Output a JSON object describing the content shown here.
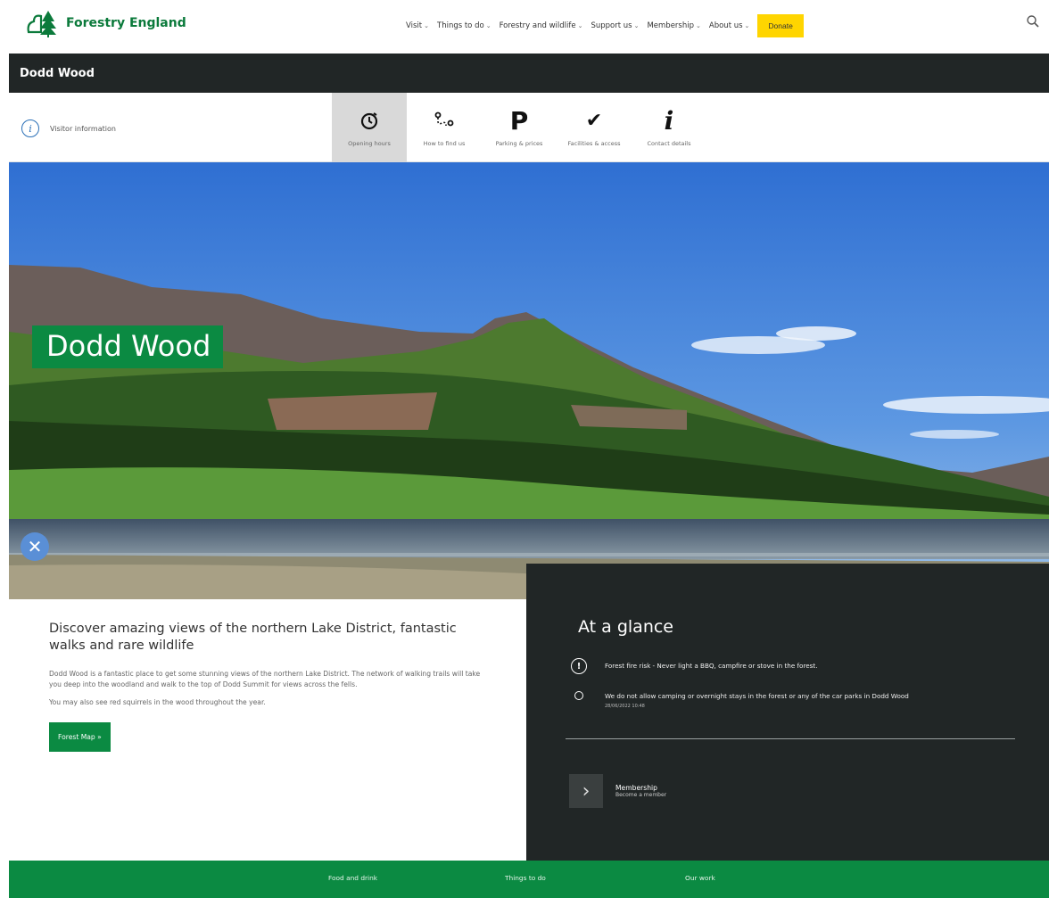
{
  "brand": {
    "name": "Forestry England"
  },
  "nav": {
    "items": [
      {
        "label": "Visit"
      },
      {
        "label": "Things to do"
      },
      {
        "label": "Forestry and wildlife"
      },
      {
        "label": "Support us"
      },
      {
        "label": "Membership"
      },
      {
        "label": "About us"
      }
    ],
    "chevron": "⌄",
    "donate_label": "Donate"
  },
  "title_bar": {
    "title": "Dodd Wood"
  },
  "visitor_info": {
    "label": "Visitor information",
    "tabs": [
      {
        "label": "Opening hours",
        "icon": "clock-icon",
        "active": true
      },
      {
        "label": "How to find us",
        "icon": "route-icon",
        "active": false
      },
      {
        "label": "Parking & prices",
        "icon": "parking-icon",
        "active": false
      },
      {
        "label": "Facilities & access",
        "icon": "checkmark-icon",
        "active": false
      },
      {
        "label": "Contact details",
        "icon": "info-icon",
        "active": false
      }
    ]
  },
  "hero": {
    "title": "Dodd Wood"
  },
  "intro": {
    "heading": "Discover amazing views of the northern Lake District, fantastic walks and rare wildlife",
    "paragraph1": "Dodd Wood is a fantastic place to get some stunning views of the northern Lake District. The network of walking trails will take you deep into the woodland and walk to the top of Dodd Summit for views across the fells.",
    "paragraph2": "You may also see red squirrels in the wood throughout the year.",
    "map_button": "Forest Map »"
  },
  "glance": {
    "title": "At a glance",
    "items": [
      {
        "icon": "alert-icon",
        "text": "Forest fire risk - Never light a BBQ, campfire or stove in the forest."
      },
      {
        "icon": "circle-icon",
        "text": "We do not allow camping or overnight stays in the forest or any of the car parks in Dodd Wood",
        "date": "28/06/2022 10:48"
      }
    ],
    "membership_title": "Membership",
    "membership_sub": "Become a member"
  },
  "footer": {
    "links": [
      "Food and drink",
      "Things to do",
      "Our work"
    ]
  },
  "colors": {
    "brand_green": "#0b8a42",
    "dark_bar": "#212626",
    "donate_yellow": "#ffd500",
    "info_blue": "#2b70b7"
  }
}
